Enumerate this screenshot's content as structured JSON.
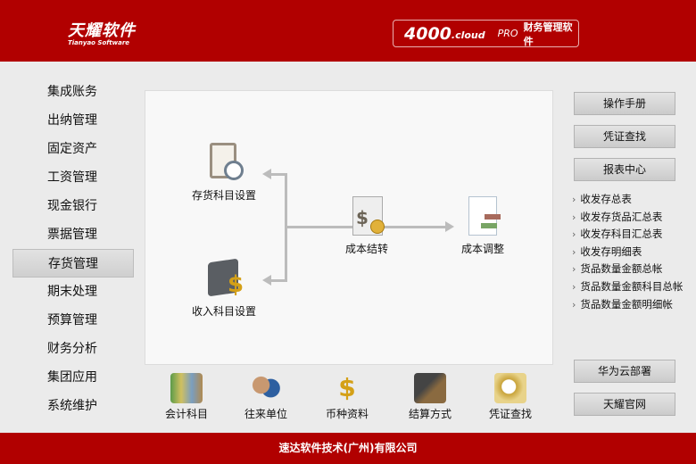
{
  "header": {
    "logo_cn": "天耀软件",
    "logo_en": "Tianyao Software",
    "product_num": "4000",
    "product_cloud": ".cloud",
    "product_pro": "PRO",
    "product_sub": "财务管理软件"
  },
  "sidebar": {
    "items": [
      {
        "label": "集成账务"
      },
      {
        "label": "出纳管理"
      },
      {
        "label": "固定资产"
      },
      {
        "label": "工资管理"
      },
      {
        "label": "现金银行"
      },
      {
        "label": "票据管理"
      },
      {
        "label": "存货管理",
        "active": true
      },
      {
        "label": "期末处理"
      },
      {
        "label": "预算管理"
      },
      {
        "label": "财务分析"
      },
      {
        "label": "集团应用"
      },
      {
        "label": "系统维护"
      }
    ]
  },
  "flow": {
    "inventory_setup": "存货科目设置",
    "income_setup": "收入科目设置",
    "cost_transfer": "成本结转",
    "cost_adjust": "成本调整"
  },
  "toolbar": [
    "会计科目",
    "往来单位",
    "币种资料",
    "结算方式",
    "凭证查找"
  ],
  "right": {
    "manual": "操作手册",
    "voucher_search": "凭证查找",
    "report_center": "报表中心",
    "huawei": "华为云部署",
    "official": "天耀官网",
    "reports": [
      "收发存总表",
      "收发存货品汇总表",
      "收发存科目汇总表",
      "收发存明细表",
      "货品数量金额总帐",
      "货品数量金额科目总帐",
      "货品数量金额明细帐"
    ]
  },
  "footer": "速达软件技术(广州)有限公司",
  "colors": {
    "brand": "#b10000"
  }
}
